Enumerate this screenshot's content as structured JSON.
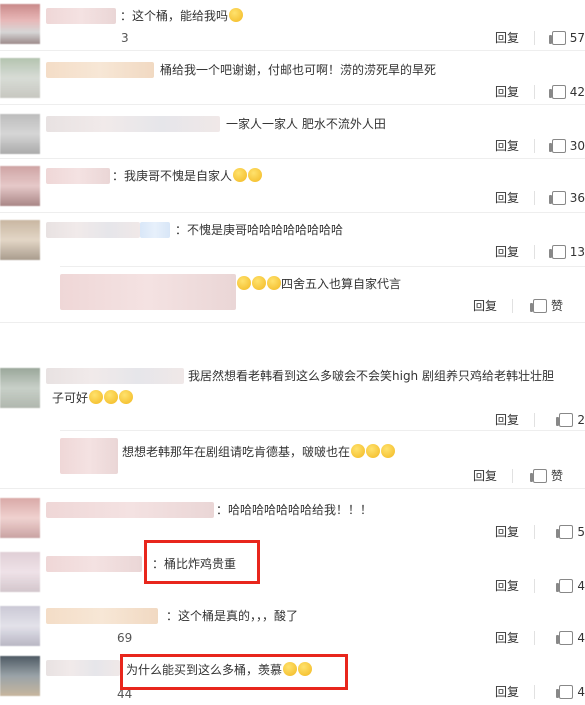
{
  "comments": [
    {
      "text": "：这个桶，能给我吗",
      "reply": "回复",
      "likes": "57"
    },
    {
      "text": "桶给我一个吧谢谢，付邮也可啊！涝的涝死旱的旱死",
      "reply": "回复",
      "likes": "42"
    },
    {
      "text": "一家人一家人 肥水不流外人田",
      "reply": "回复",
      "likes": "30"
    },
    {
      "text": "：我庚哥不愧是自家人",
      "reply": "回复",
      "likes": "36"
    },
    {
      "text": "：不愧是庚哥哈哈哈哈哈哈哈哈",
      "reply": "回复",
      "likes": "13"
    },
    {
      "text": "四舍五入也算自家代言",
      "reply": "回复",
      "likes": "赞"
    },
    {
      "text": "我居然想看老韩看到这么多啵会不会笑high    剧组养只鸡给老韩壮壮胆",
      "text2": "子可好",
      "reply": "回复",
      "likes": "2"
    },
    {
      "text": "想想老韩那年在剧组请吃肯德基，啵啵也在",
      "reply": "回复",
      "likes": "赞"
    },
    {
      "text": "：哈哈哈哈哈哈哈给我！！！",
      "reply": "回复",
      "likes": "5"
    },
    {
      "text": "：桶比炸鸡贵重",
      "reply": "回复",
      "likes": "4"
    },
    {
      "text": "：这个桶是真的，，，酸了",
      "reply": "回复",
      "likes": "4"
    },
    {
      "text": "为什么能买到这么多桶，羡慕",
      "reply": "回复",
      "likes": "4"
    }
  ],
  "stray_digits": {
    "a": "3",
    "b": "9",
    "c": "69",
    "d": "44"
  },
  "colors": {
    "highlight": "#e8261c"
  }
}
